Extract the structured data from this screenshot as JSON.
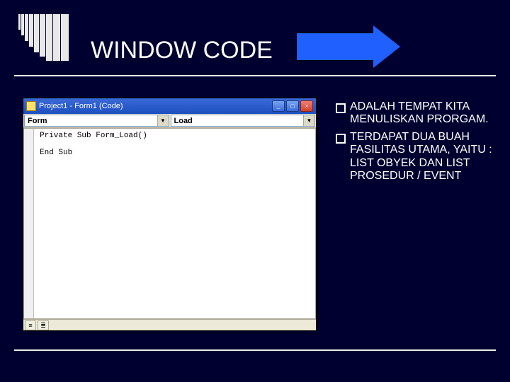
{
  "title": "WINDOW CODE",
  "codewin": {
    "title": "Project1 - Form1 (Code)",
    "object_dd": "Form",
    "proc_dd": "Load",
    "code": "Private Sub Form_Load()\n\nEnd Sub",
    "min": "_",
    "max": "□",
    "close": "×",
    "dd_caret": "▼",
    "view1": "≡",
    "view2": "≣"
  },
  "bullets": {
    "b1": "ADALAH TEMPAT KITA MENULISKAN PRORGAM.",
    "b2": "TERDAPAT DUA BUAH FASILITAS UTAMA, YAITU : LIST OBYEK DAN LIST PROSEDUR / EVENT"
  }
}
